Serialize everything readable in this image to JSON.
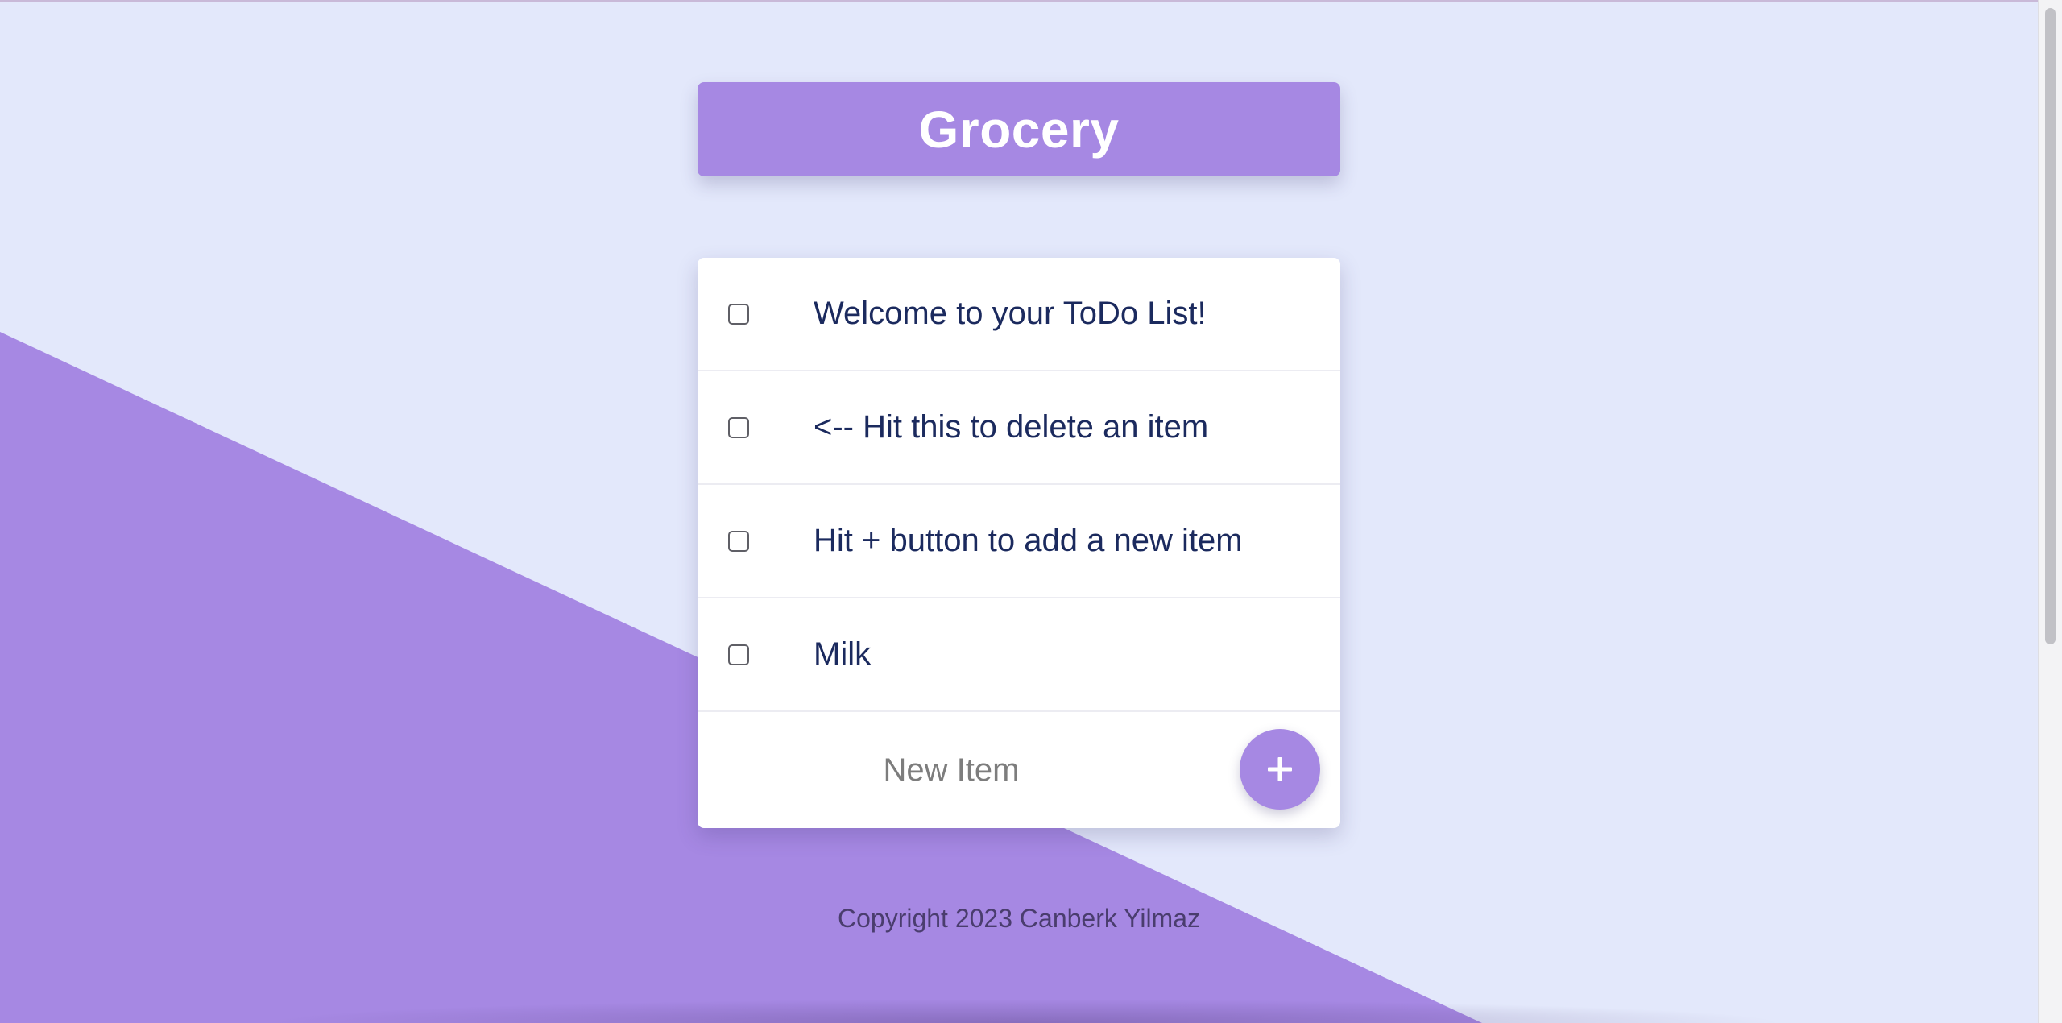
{
  "header": {
    "title": "Grocery"
  },
  "list": {
    "items": [
      {
        "label": "Welcome to your ToDo List!",
        "checked": false
      },
      {
        "label": "<-- Hit this to delete an item",
        "checked": false
      },
      {
        "label": "Hit + button to add a new item",
        "checked": false
      },
      {
        "label": "Milk",
        "checked": false
      }
    ],
    "new_item": {
      "placeholder": "New Item",
      "value": ""
    },
    "add_button_label": "+"
  },
  "footer": {
    "copyright": "Copyright 2023 Canberk Yilmaz"
  },
  "colors": {
    "accent": "#a688e3",
    "background": "#e3e8fb",
    "card": "#ffffff",
    "item_text": "#1b2a5e"
  }
}
